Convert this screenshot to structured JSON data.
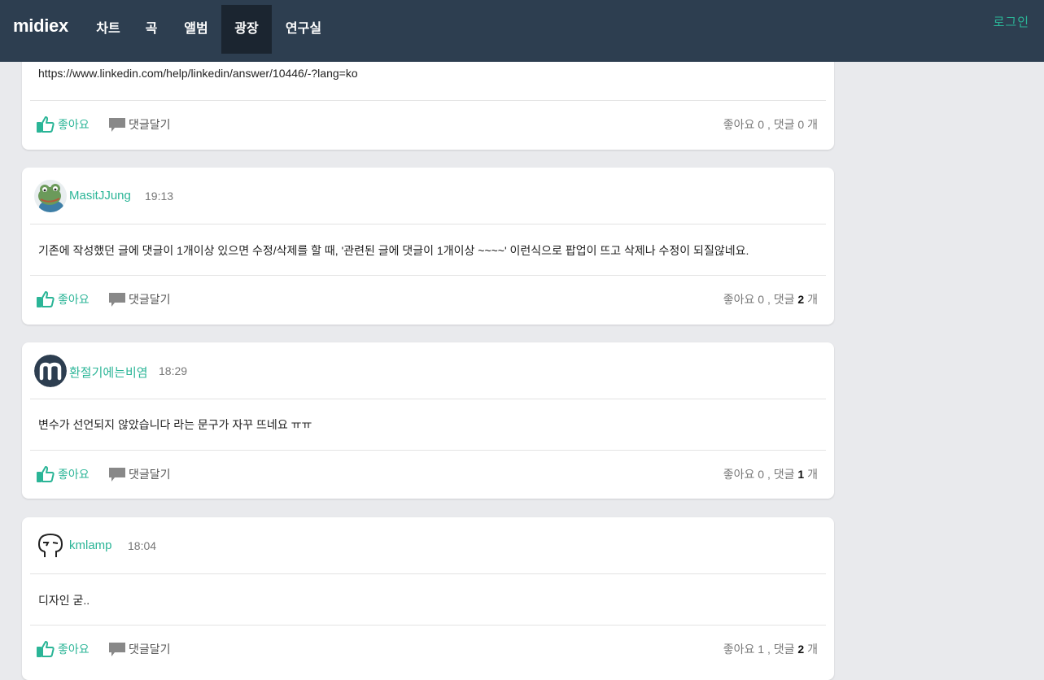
{
  "nav": {
    "logo": "midiex",
    "items": [
      "차트",
      "곡",
      "앨범",
      "광장",
      "연구실"
    ],
    "active": "광장",
    "login": "로그인"
  },
  "actions": {
    "like_label": "좋아요",
    "comment_label": "댓글달기"
  },
  "posts": [
    {
      "content": "https://www.linkedin.com/help/linkedin/answer/10446/-?lang=ko",
      "likes": "0",
      "comments": "0"
    },
    {
      "author": "MasitJJung",
      "time": "19:13",
      "content": "기존에 작성했던 글에 댓글이 1개이상 있으면 수정/삭제를 할 때, '관련된 글에 댓글이 1개이상 ~~~~' 이런식으로 팝업이 뜨고 삭제나 수정이 되질않네요.",
      "likes": "0",
      "comments": "2"
    },
    {
      "author": "환절기에는비염",
      "time": "18:29",
      "content": "변수가 선언되지 않았습니다 라는 문구가 자꾸 뜨네요 ㅠㅠ",
      "likes": "0",
      "comments": "1"
    },
    {
      "author": "kmlamp",
      "time": "18:04",
      "content": "디자인 굳..",
      "likes": "1",
      "comments": "2"
    }
  ],
  "stats_format": {
    "like_prefix": "좋아요 ",
    "separator": " , 댓글 ",
    "suffix": " 개"
  },
  "colors": {
    "nav_bg": "#2d3e50",
    "accent": "#2bb597",
    "page_bg": "#e9eaed"
  }
}
